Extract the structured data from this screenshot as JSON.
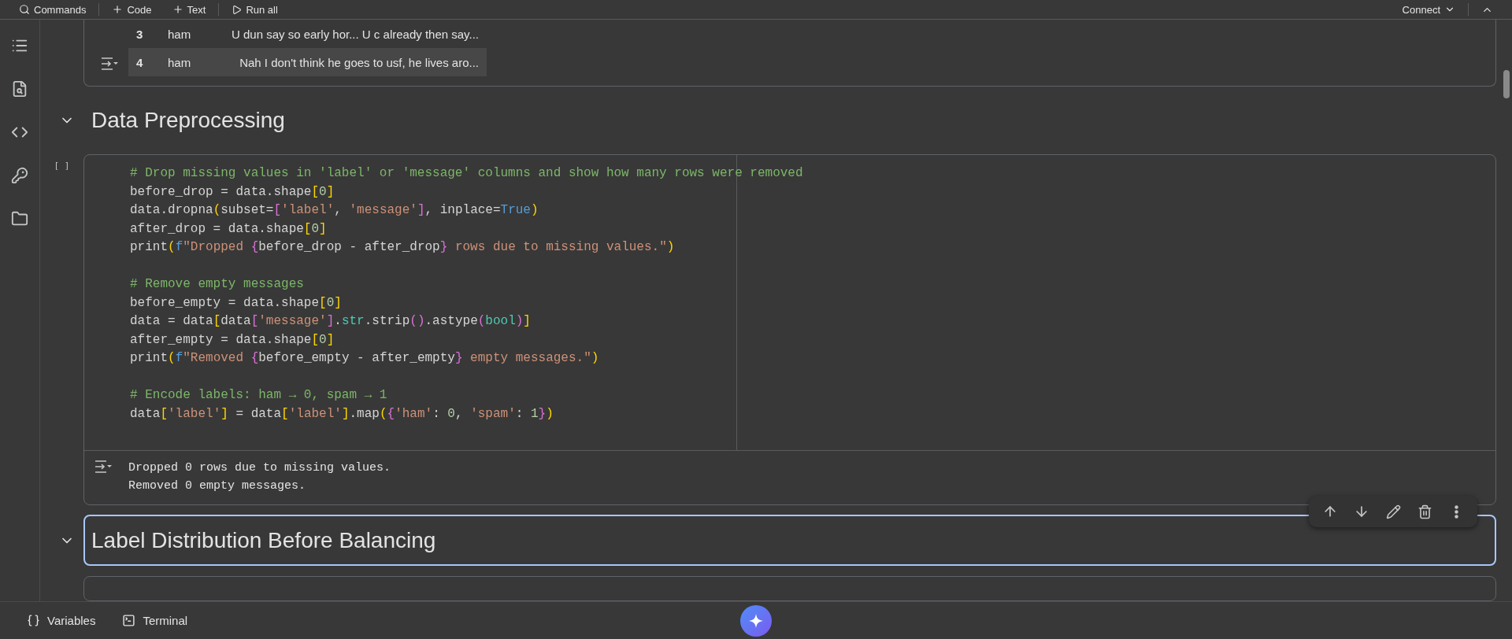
{
  "toolbar": {
    "items": [
      {
        "kind": "search",
        "label": "Commands"
      },
      {
        "kind": "add",
        "label": "Code"
      },
      {
        "kind": "add",
        "label": "Text"
      },
      {
        "kind": "run",
        "label": "Run all"
      }
    ],
    "connect": "Connect"
  },
  "output_table": {
    "rows": [
      {
        "index": "3",
        "label": "ham",
        "message": "U dun say so early hor... U c already then say...",
        "hovered": false
      },
      {
        "index": "4",
        "label": "ham",
        "message": "Nah I don't think he goes to usf, he lives aro...",
        "hovered": true
      }
    ]
  },
  "section_1": {
    "title": "Data Preprocessing",
    "expanded": true,
    "selected": false
  },
  "code_cell": {
    "run_marker": "[ ]",
    "lines": [
      {
        "space_before": false,
        "tokens": [
          {
            "kind": "comment",
            "t": "# Drop missing values in 'label' or 'message' columns and show how many rows were removed"
          }
        ]
      },
      {
        "space_before": false,
        "tokens": [
          {
            "kind": "plain",
            "t": "before_drop = data.shape"
          },
          {
            "kind": "b1",
            "t": "["
          },
          {
            "kind": "number",
            "t": "0"
          },
          {
            "kind": "b1",
            "t": "]"
          }
        ]
      },
      {
        "space_before": false,
        "tokens": [
          {
            "kind": "plain",
            "t": "data.dropna"
          },
          {
            "kind": "b1",
            "t": "("
          },
          {
            "kind": "plain",
            "t": "subset="
          },
          {
            "kind": "b2",
            "t": "["
          },
          {
            "kind": "string",
            "t": "'label'"
          },
          {
            "kind": "plain",
            "t": ", "
          },
          {
            "kind": "string",
            "t": "'message'"
          },
          {
            "kind": "b2",
            "t": "]"
          },
          {
            "kind": "plain",
            "t": ", inplace="
          },
          {
            "kind": "keyword",
            "t": "True"
          },
          {
            "kind": "b1",
            "t": ")"
          }
        ]
      },
      {
        "space_before": false,
        "tokens": [
          {
            "kind": "plain",
            "t": "after_drop = data.shape"
          },
          {
            "kind": "b1",
            "t": "["
          },
          {
            "kind": "number",
            "t": "0"
          },
          {
            "kind": "b1",
            "t": "]"
          }
        ]
      },
      {
        "space_before": false,
        "tokens": [
          {
            "kind": "plain",
            "t": "print"
          },
          {
            "kind": "b1",
            "t": "("
          },
          {
            "kind": "keyword",
            "t": "f"
          },
          {
            "kind": "string",
            "t": "\"Dropped "
          },
          {
            "kind": "b2",
            "t": "{"
          },
          {
            "kind": "plain",
            "t": "before_drop - after_drop"
          },
          {
            "kind": "b2",
            "t": "}"
          },
          {
            "kind": "string",
            "t": " rows due to missing values.\""
          },
          {
            "kind": "b1",
            "t": ")"
          }
        ]
      },
      {
        "space_before": true,
        "tokens": [
          {
            "kind": "comment",
            "t": "# Remove empty messages"
          }
        ]
      },
      {
        "space_before": false,
        "tokens": [
          {
            "kind": "plain",
            "t": "before_empty = data.shape"
          },
          {
            "kind": "b1",
            "t": "["
          },
          {
            "kind": "number",
            "t": "0"
          },
          {
            "kind": "b1",
            "t": "]"
          }
        ]
      },
      {
        "space_before": false,
        "tokens": [
          {
            "kind": "plain",
            "t": "data = data"
          },
          {
            "kind": "b1",
            "t": "["
          },
          {
            "kind": "plain",
            "t": "data"
          },
          {
            "kind": "b2",
            "t": "["
          },
          {
            "kind": "string",
            "t": "'message'"
          },
          {
            "kind": "b2",
            "t": "]"
          },
          {
            "kind": "plain",
            "t": "."
          },
          {
            "kind": "builtin",
            "t": "str"
          },
          {
            "kind": "plain",
            "t": ".strip"
          },
          {
            "kind": "b2",
            "t": "()"
          },
          {
            "kind": "plain",
            "t": ".astype"
          },
          {
            "kind": "b2",
            "t": "("
          },
          {
            "kind": "builtin",
            "t": "bool"
          },
          {
            "kind": "b2",
            "t": ")"
          },
          {
            "kind": "b1",
            "t": "]"
          }
        ]
      },
      {
        "space_before": false,
        "tokens": [
          {
            "kind": "plain",
            "t": "after_empty = data.shape"
          },
          {
            "kind": "b1",
            "t": "["
          },
          {
            "kind": "number",
            "t": "0"
          },
          {
            "kind": "b1",
            "t": "]"
          }
        ]
      },
      {
        "space_before": false,
        "tokens": [
          {
            "kind": "plain",
            "t": "print"
          },
          {
            "kind": "b1",
            "t": "("
          },
          {
            "kind": "keyword",
            "t": "f"
          },
          {
            "kind": "string",
            "t": "\"Removed "
          },
          {
            "kind": "b2",
            "t": "{"
          },
          {
            "kind": "plain",
            "t": "before_empty - after_empty"
          },
          {
            "kind": "b2",
            "t": "}"
          },
          {
            "kind": "string",
            "t": " empty messages.\""
          },
          {
            "kind": "b1",
            "t": ")"
          }
        ]
      },
      {
        "space_before": true,
        "tokens": [
          {
            "kind": "comment",
            "t": "# Encode labels: ham → 0, spam → 1"
          }
        ]
      },
      {
        "space_before": false,
        "tokens": [
          {
            "kind": "plain",
            "t": "data"
          },
          {
            "kind": "b1",
            "t": "["
          },
          {
            "kind": "string",
            "t": "'label'"
          },
          {
            "kind": "b1",
            "t": "]"
          },
          {
            "kind": "plain",
            "t": " = data"
          },
          {
            "kind": "b1",
            "t": "["
          },
          {
            "kind": "string",
            "t": "'label'"
          },
          {
            "kind": "b1",
            "t": "]"
          },
          {
            "kind": "plain",
            "t": ".map"
          },
          {
            "kind": "b1",
            "t": "("
          },
          {
            "kind": "b2",
            "t": "{"
          },
          {
            "kind": "string",
            "t": "'ham'"
          },
          {
            "kind": "plain",
            "t": ": "
          },
          {
            "kind": "number",
            "t": "0"
          },
          {
            "kind": "plain",
            "t": ", "
          },
          {
            "kind": "string",
            "t": "'spam'"
          },
          {
            "kind": "plain",
            "t": ": "
          },
          {
            "kind": "number",
            "t": "1"
          },
          {
            "kind": "b2",
            "t": "}"
          },
          {
            "kind": "b1",
            "t": ")"
          }
        ]
      }
    ],
    "output": [
      "Dropped 0 rows due to missing values.",
      "Removed 0 empty messages."
    ]
  },
  "section_2": {
    "title": "Label Distribution Before Balancing",
    "expanded": true,
    "selected": true
  },
  "bottom_bar": {
    "items": [
      {
        "kind": "variables",
        "label": "Variables"
      },
      {
        "kind": "terminal",
        "label": "Terminal"
      }
    ]
  }
}
